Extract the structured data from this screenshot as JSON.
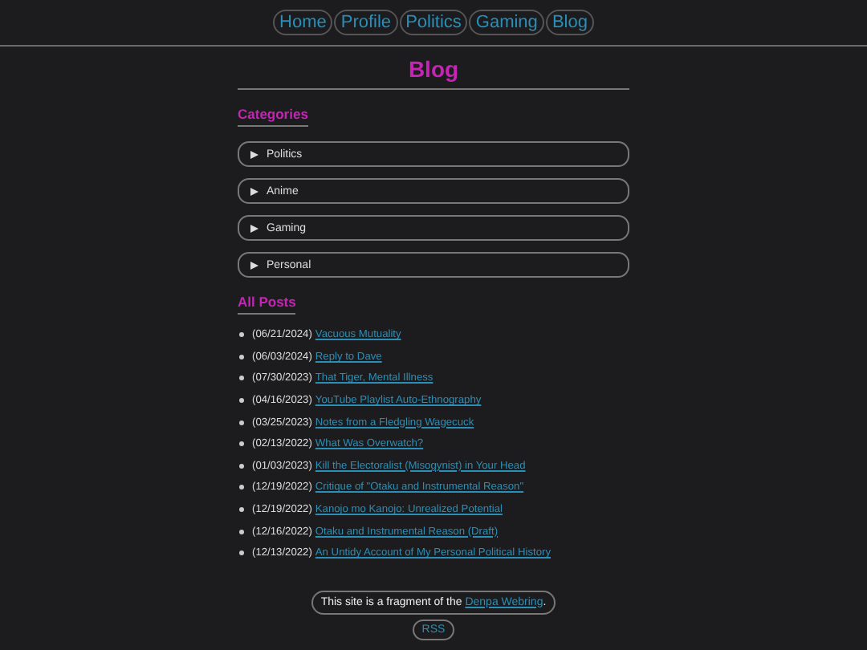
{
  "nav": [
    {
      "label": "Home"
    },
    {
      "label": "Profile"
    },
    {
      "label": "Politics"
    },
    {
      "label": "Gaming"
    },
    {
      "label": "Blog"
    }
  ],
  "title": "Blog",
  "categories": {
    "heading": "Categories",
    "items": [
      {
        "label": "Politics",
        "expanded": false
      },
      {
        "label": "Anime",
        "expanded": false
      },
      {
        "label": "Gaming",
        "expanded": false
      },
      {
        "label": "Personal",
        "expanded": false
      }
    ]
  },
  "posts": {
    "heading": "All Posts",
    "items": [
      {
        "date": "(06/21/2024)",
        "title": "Vacuous Mutuality"
      },
      {
        "date": "(06/03/2024)",
        "title": "Reply to Dave"
      },
      {
        "date": "(07/30/2023)",
        "title": "That Tiger, Mental Illness"
      },
      {
        "date": "(04/16/2023)",
        "title": "YouTube Playlist Auto-Ethnography"
      },
      {
        "date": "(03/25/2023)",
        "title": "Notes from a Fledgling Wagecuck"
      },
      {
        "date": "(02/13/2022)",
        "title": "What Was Overwatch?"
      },
      {
        "date": "(01/03/2023)",
        "title": "Kill the Electoralist (Misogynist) in Your Head"
      },
      {
        "date": "(12/19/2022)",
        "title": "Critique of \"Otaku and Instrumental Reason\""
      },
      {
        "date": "(12/19/2022)",
        "title": "Kanojo mo Kanojo: Unrealized Potential"
      },
      {
        "date": "(12/16/2022)",
        "title": "Otaku and Instrumental Reason (Draft)"
      },
      {
        "date": "(12/13/2022)",
        "title": "An Untidy Account of My Personal Political History"
      }
    ]
  },
  "footer": {
    "text": "This site is a fragment of the ",
    "link": "Denpa Webring",
    "after": ".",
    "rss": "RSS"
  }
}
